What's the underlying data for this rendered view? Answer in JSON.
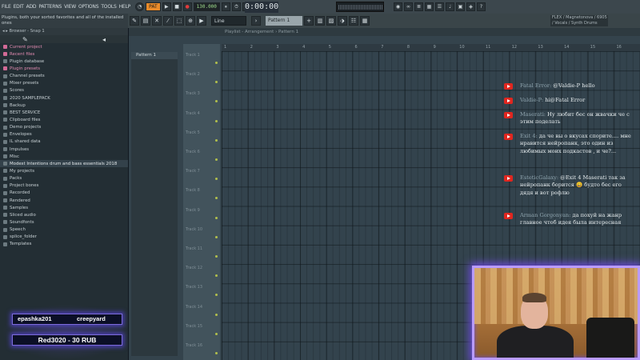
{
  "menus": [
    "FILE",
    "EDIT",
    "ADD",
    "PATTERNS",
    "VIEW",
    "OPTIONS",
    "TOOLS",
    "HELP"
  ],
  "transport": {
    "mode": "PAT",
    "play": "▶",
    "stop": "■",
    "record": "●",
    "tempo": "130.000",
    "time": "0:00:00"
  },
  "hint": "Plugins, both your sorted favorites and all of the installed ones",
  "toolbar2": {
    "line_select": "Line",
    "pattern_select": "Pattern 1",
    "plugin_info": "FLEX / Magnetonova / 6905 / Vocals / Synth Drums"
  },
  "browser": {
    "header": "◂ ▸ Browser - Snap 1",
    "tools": [
      "✎",
      "◂"
    ],
    "items": [
      {
        "label": "Current project",
        "kind": "pink"
      },
      {
        "label": "Recent files",
        "kind": "pink"
      },
      {
        "label": "Plugin database",
        "kind": "normal"
      },
      {
        "label": "Plugin presets",
        "kind": "pink"
      },
      {
        "label": "Channel presets",
        "kind": "normal"
      },
      {
        "label": "Mixer presets",
        "kind": "normal"
      },
      {
        "label": "Scores",
        "kind": "normal"
      },
      {
        "label": "2020 SAMPLEPACK",
        "kind": "normal"
      },
      {
        "label": "Backup",
        "kind": "normal"
      },
      {
        "label": "BEST SERVICE",
        "kind": "normal"
      },
      {
        "label": "Clipboard files",
        "kind": "normal"
      },
      {
        "label": "Demo projects",
        "kind": "normal"
      },
      {
        "label": "Envelopes",
        "kind": "normal"
      },
      {
        "label": "IL shared data",
        "kind": "normal"
      },
      {
        "label": "Impulses",
        "kind": "normal"
      },
      {
        "label": "Misc",
        "kind": "normal"
      },
      {
        "label": "Modest Intentions drum and bass essentials 2018",
        "kind": "sel"
      },
      {
        "label": "My projects",
        "kind": "normal"
      },
      {
        "label": "Packs",
        "kind": "normal"
      },
      {
        "label": "Project bones",
        "kind": "normal"
      },
      {
        "label": "Recorded",
        "kind": "normal"
      },
      {
        "label": "Rendered",
        "kind": "normal"
      },
      {
        "label": "Samples",
        "kind": "normal"
      },
      {
        "label": "Sliced audio",
        "kind": "normal"
      },
      {
        "label": "Soundfonts",
        "kind": "normal"
      },
      {
        "label": "Speech",
        "kind": "normal"
      },
      {
        "label": "splice_folder",
        "kind": "normal"
      },
      {
        "label": "Templates",
        "kind": "normal"
      }
    ]
  },
  "playlist": {
    "title": "Playlist - Arrangement › Pattern 1",
    "pattern": "Pattern 1",
    "tracks": [
      "Track 1",
      "Track 2",
      "Track 3",
      "Track 4",
      "Track 5",
      "Track 6",
      "Track 7",
      "Track 8",
      "Track 9",
      "Track 10",
      "Track 11",
      "Track 12",
      "Track 13",
      "Track 14",
      "Track 15",
      "Track 16"
    ],
    "ruler": [
      "1",
      "2",
      "3",
      "4",
      "5",
      "6",
      "7",
      "8",
      "9",
      "10",
      "11",
      "12",
      "13",
      "14",
      "15",
      "16"
    ]
  },
  "chat": [
    {
      "name": "Fatal Error:",
      "text": "@Valdie-P hello"
    },
    {
      "name": "Valdie-P:",
      "text": "hi@Fatal Error"
    },
    {
      "name": "Maserati:",
      "text": "Ну любит бес он жвачки че с этим поделать"
    },
    {
      "name": "Exit 4:",
      "text": "да че вы о вкусах спорите.... мне нравится нейропанк, это один из любимых моих подкастов , и че?..."
    },
    {
      "name": "EsteticGalaxy:",
      "text": "@Exit 4 Maserati так за нейропанк борится 😀 будто бес его дядя и вот рофлю"
    },
    {
      "name": "Arman Gorgonyan:",
      "text": "да похуй на жанр главное чтоб идея была интересная"
    }
  ],
  "donors": {
    "left": "epashka201",
    "right": "creepyard",
    "donation": "Red3020 - 30 RUB"
  },
  "colors": {
    "accent": "#b99bff",
    "youtube": "#e0261f",
    "browser_pink": "#e28bb1"
  }
}
